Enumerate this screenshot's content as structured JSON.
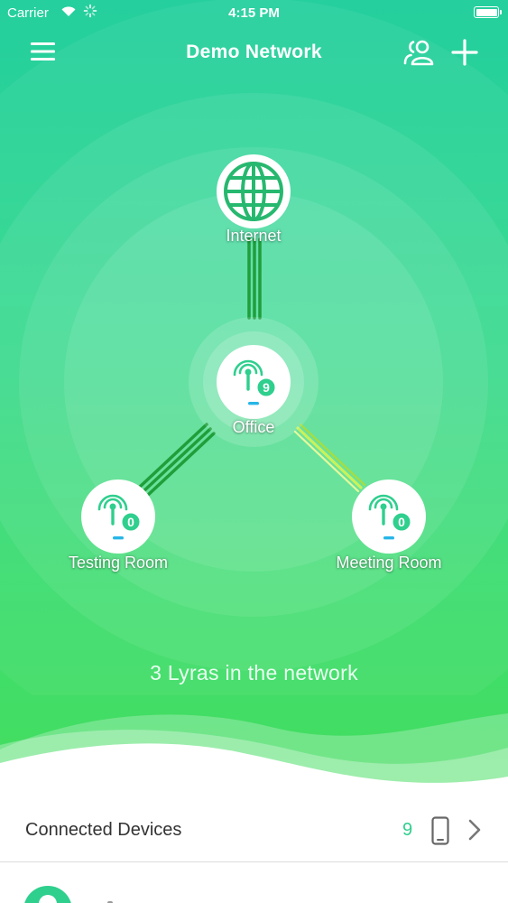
{
  "status_bar": {
    "carrier": "Carrier",
    "time": "4:15 PM"
  },
  "nav": {
    "title": "Demo Network",
    "icons": [
      "menu-icon",
      "users-icon",
      "plus-icon"
    ]
  },
  "topology": {
    "internet": {
      "label": "Internet",
      "icon": "globe-icon"
    },
    "nodes": [
      {
        "label": "Office",
        "count": "9",
        "icon": "router-icon"
      },
      {
        "label": "Testing Room",
        "count": "0",
        "icon": "router-icon"
      },
      {
        "label": "Meeting Room",
        "count": "0",
        "icon": "router-icon"
      }
    ],
    "link_colors": {
      "strong": "#1f9e3a",
      "medium": "#c9f25a"
    }
  },
  "network_summary": "3 Lyras in the network",
  "connected_devices": {
    "label": "Connected Devices",
    "count": "9",
    "icon": "phone-icon"
  },
  "colors": {
    "accent": "#2fcf8e",
    "hero_top": "#25cf9e",
    "hero_bottom": "#45dd5e"
  }
}
